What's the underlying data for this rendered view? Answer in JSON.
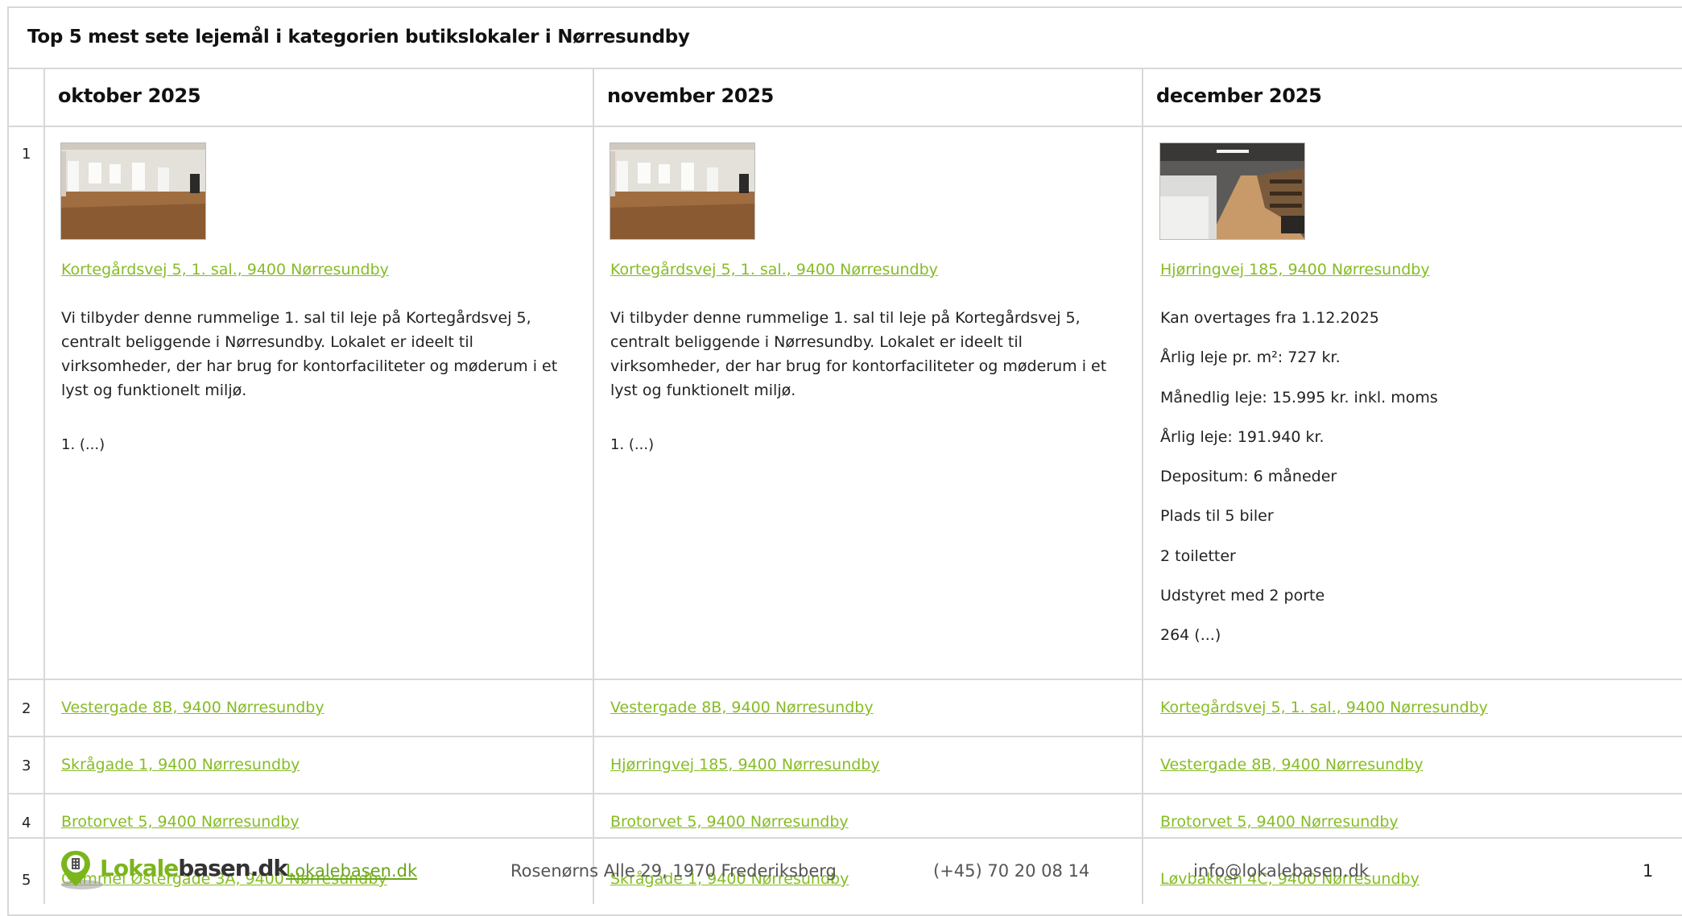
{
  "title": "Top 5 mest sete lejemål i kategorien butikslokaler i Nørresundby",
  "columns": [
    {
      "header": "oktober 2025",
      "top": {
        "link": "Kortegårdsvej 5, 1. sal., 9400 Nørresundby",
        "description": "Vi tilbyder denne rummelige 1. sal til leje på Kortegårdsvej 5, centralt beliggende i Nørresundby. Lokalet er ideelt til virksomheder, der har brug for kontorfaciliteter og møderum i et lyst og funktionelt miljø.",
        "more": "1. (...)"
      },
      "rows": [
        "Vestergade 8B, 9400 Nørresundby",
        "Skrågade 1, 9400 Nørresundby",
        "Brotorvet 5, 9400 Nørresundby",
        "Gammel Østergade 3A, 9400 Nørresundby"
      ]
    },
    {
      "header": "november 2025",
      "top": {
        "link": "Kortegårdsvej 5, 1. sal., 9400 Nørresundby",
        "description": "Vi tilbyder denne rummelige 1. sal til leje på Kortegårdsvej 5, centralt beliggende i Nørresundby. Lokalet er ideelt til virksomheder, der har brug for kontorfaciliteter og møderum i et lyst og funktionelt miljø.",
        "more": "1. (...)"
      },
      "rows": [
        "Vestergade 8B, 9400 Nørresundby",
        "Hjørringvej 185, 9400 Nørresundby",
        "Brotorvet 5, 9400 Nørresundby",
        "Skrågade 1, 9400 Nørresundby"
      ]
    },
    {
      "header": "december 2025",
      "top": {
        "link": "Hjørringvej 185, 9400 Nørresundby",
        "info": [
          "Kan overtages fra 1.12.2025",
          "Årlig leje pr. m²: 727 kr.",
          "Månedlig leje: 15.995 kr. inkl. moms",
          "Årlig leje: 191.940 kr.",
          "Depositum: 6 måneder",
          "Plads til 5 biler",
          "2 toiletter",
          "Udstyret med 2 porte"
        ],
        "more": "264 (...)"
      },
      "rows": [
        "Kortegårdsvej 5, 1. sal., 9400 Nørresundby",
        "Vestergade 8B, 9400 Nørresundby",
        "Brotorvet 5, 9400 Nørresundby",
        "Løvbakken 4C, 9400 Nørresundby"
      ]
    }
  ],
  "row_numbers": [
    "1",
    "2",
    "3",
    "4",
    "5"
  ],
  "footer": {
    "logo_green": "Lokale",
    "logo_dark": "basen.dk",
    "site_link": "Lokalebasen.dk",
    "address": "Rosenørns Alle 29, 1970 Frederiksberg",
    "phone": "(+45) 70 20 08 14",
    "email": "info@lokalebasen.dk",
    "page_number": "1"
  }
}
